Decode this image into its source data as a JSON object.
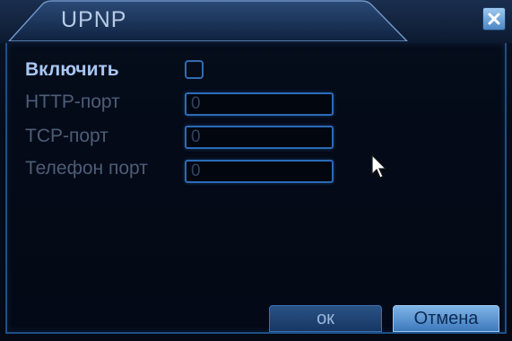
{
  "window": {
    "title": "UPNP"
  },
  "form": {
    "enable_label": "Включить",
    "enable_checked": false,
    "http_port_label": "HTTP-порт",
    "http_port_value": "0",
    "tcp_port_label": "TCP-порт",
    "tcp_port_value": "0",
    "phone_port_label": "Телефон порт",
    "phone_port_value": "0"
  },
  "buttons": {
    "ok_label": "ок",
    "cancel_label": "Отмена"
  },
  "icons": {
    "close": "close-icon",
    "pointer": "mouse-pointer-icon"
  },
  "colors": {
    "accent_border": "#2a6bb8",
    "label_active": "#a9c7f2",
    "label_inactive": "#4d5d78",
    "title_text": "#b7cbe6"
  }
}
